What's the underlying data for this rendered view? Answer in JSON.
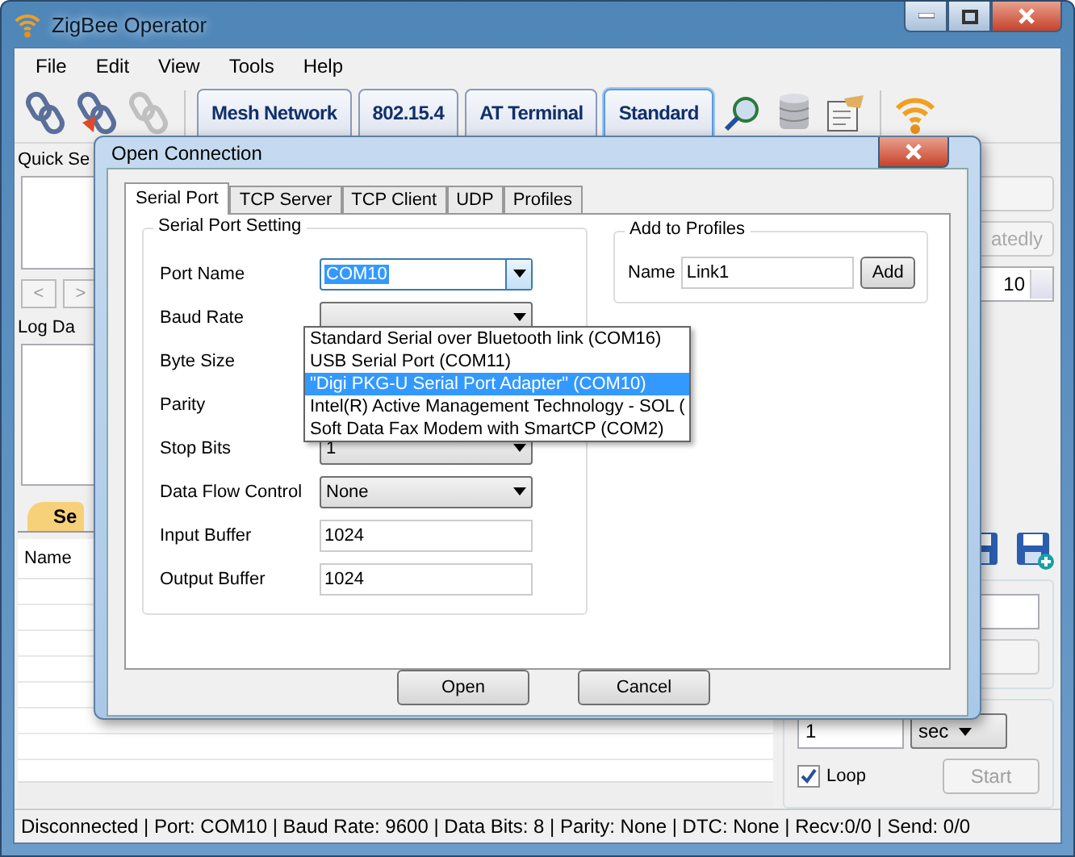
{
  "window": {
    "title": "ZigBee Operator"
  },
  "menu": [
    "File",
    "Edit",
    "View",
    "Tools",
    "Help"
  ],
  "toolbar_tabs": [
    {
      "label": "Mesh Network",
      "selected": false
    },
    {
      "label": "802.15.4",
      "selected": false
    },
    {
      "label": "AT Terminal",
      "selected": false
    },
    {
      "label": "Standard",
      "selected": true
    }
  ],
  "background": {
    "quick_label": "Quick Se",
    "nav_buttons": [
      "<",
      ">"
    ],
    "log_label": "Log Da",
    "bottom_tab": "Se",
    "column": "Name",
    "right_button": "atedly",
    "right_spinner": "10",
    "interval": "1",
    "unit": "sec",
    "loop": {
      "label": "Loop",
      "checked": true
    },
    "start": {
      "label": "Start",
      "disabled": true
    }
  },
  "dialog": {
    "title": "Open Connection",
    "tabs": [
      {
        "label": "Serial Port",
        "selected": true
      },
      {
        "label": "TCP Server",
        "selected": false
      },
      {
        "label": "TCP Client",
        "selected": false
      },
      {
        "label": "UDP",
        "selected": false
      },
      {
        "label": "Profiles",
        "selected": false
      }
    ],
    "group_title": "Serial Port Setting",
    "fields": [
      {
        "label": "Port Name",
        "kind": "combo",
        "value": "COM10",
        "focused": true
      },
      {
        "label": "Baud Rate",
        "kind": "combo"
      },
      {
        "label": "Byte Size",
        "kind": "combo"
      },
      {
        "label": "Parity",
        "kind": "combo"
      },
      {
        "label": "Stop Bits",
        "kind": "combo",
        "value": "1"
      },
      {
        "label": "Data Flow Control",
        "kind": "combo",
        "value": "None"
      },
      {
        "label": "Input Buffer",
        "kind": "text",
        "value": "1024"
      },
      {
        "label": "Output Buffer",
        "kind": "text",
        "value": "1024"
      }
    ],
    "profiles": {
      "title": "Add to Profiles",
      "name_label": "Name",
      "name_value": "Link1",
      "add": "Add"
    },
    "port_options": [
      {
        "label": "Standard Serial over Bluetooth link (COM16)",
        "selected": false
      },
      {
        "label": "USB Serial Port (COM11)",
        "selected": false
      },
      {
        "label": "\"Digi PKG-U Serial Port Adapter\" (COM10)",
        "selected": true
      },
      {
        "label": "Intel(R) Active Management Technology - SOL (",
        "selected": false
      },
      {
        "label": "Soft Data Fax Modem with SmartCP (COM2)",
        "selected": false
      }
    ],
    "buttons": [
      "Open",
      "Cancel"
    ]
  },
  "status_bar": "Disconnected | Port: COM10 | Baud Rate: 9600 | Data Bits: 8 | Parity: None | DTC: None | Recv:0/0 | Send: 0/0"
}
